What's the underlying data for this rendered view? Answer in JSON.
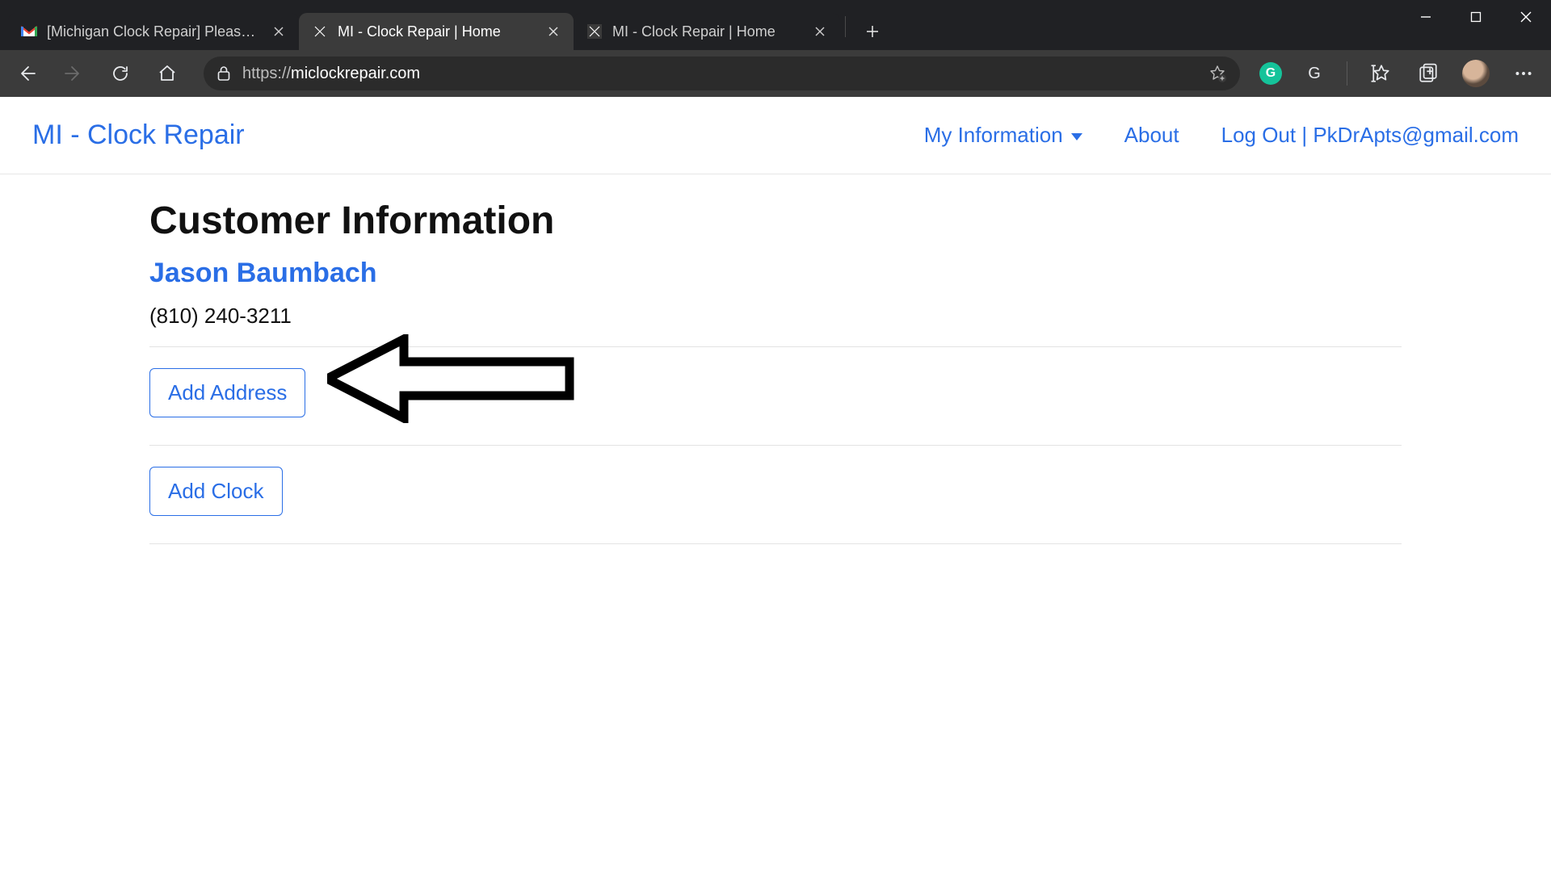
{
  "browser": {
    "tabs": [
      {
        "title": "[Michigan Clock Repair] Please C",
        "active": false,
        "favicon": "gmail"
      },
      {
        "title": "MI - Clock Repair | Home",
        "active": true,
        "favicon": "site"
      },
      {
        "title": "MI - Clock Repair | Home",
        "active": false,
        "favicon": "site"
      }
    ],
    "url_scheme": "https://",
    "url_rest": "miclockrepair.com"
  },
  "site": {
    "brand": "MI - Clock Repair",
    "nav": {
      "my_info": "My Information",
      "about": "About",
      "logout": "Log Out | PkDrApts@gmail.com"
    }
  },
  "page": {
    "title": "Customer Information",
    "customer_name": "Jason Baumbach",
    "customer_phone": "(810) 240-3211",
    "add_address_label": "Add Address",
    "add_clock_label": "Add Clock"
  }
}
